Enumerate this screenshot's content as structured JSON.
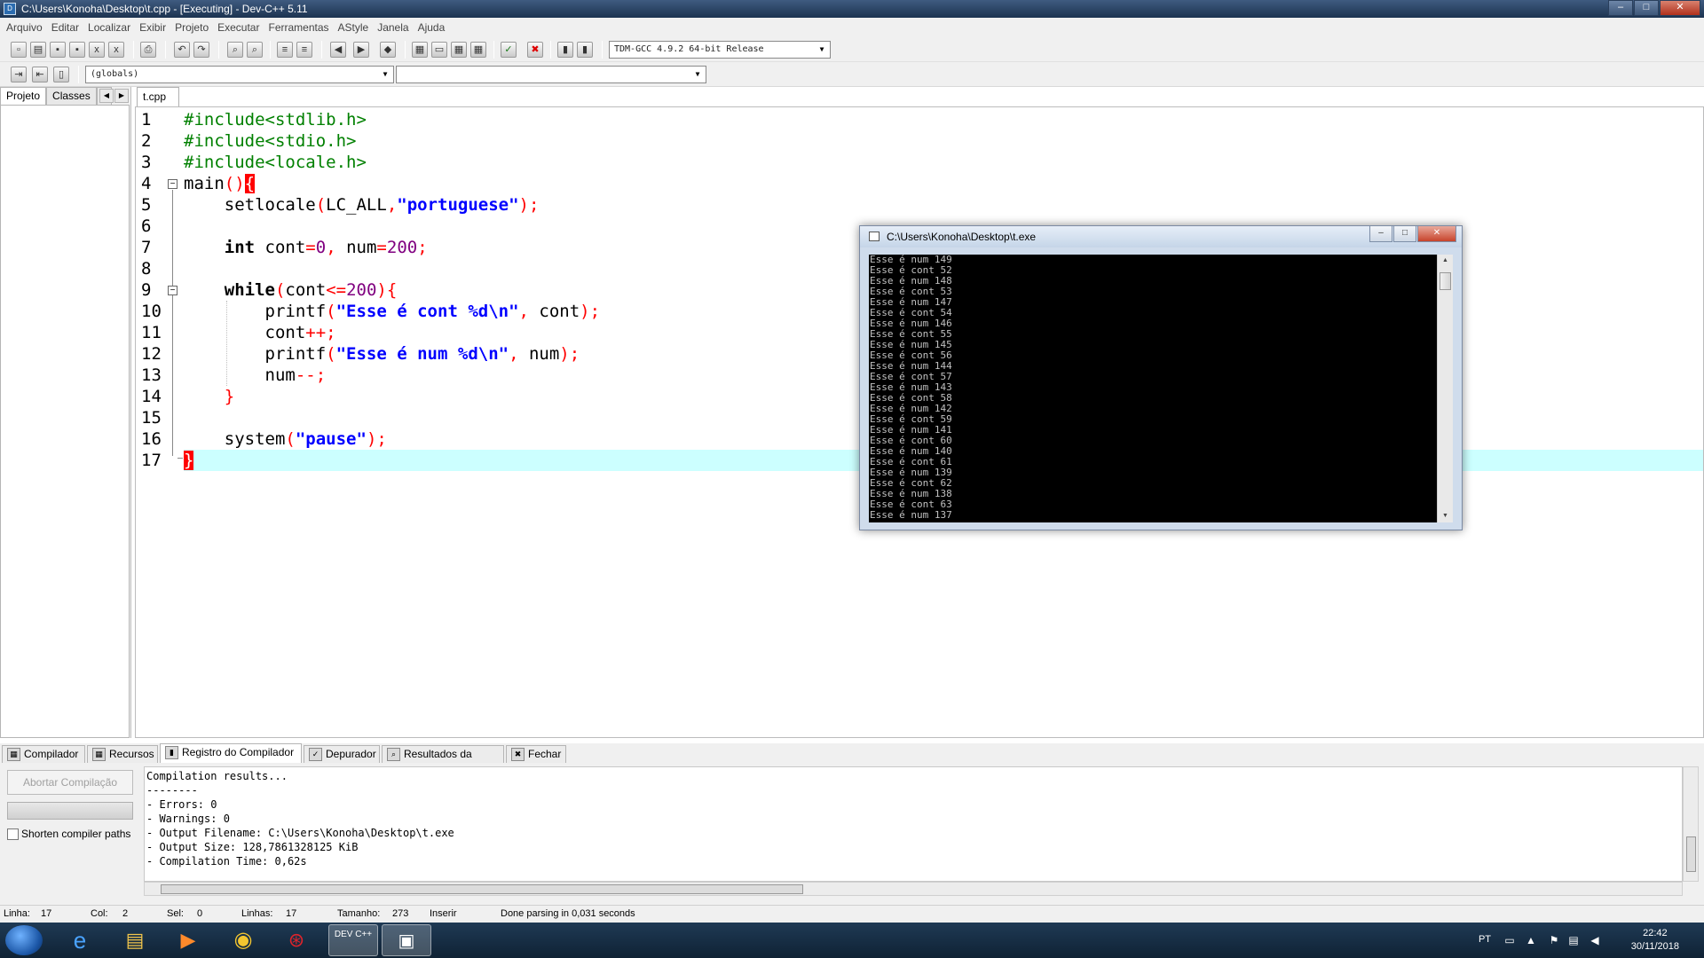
{
  "window": {
    "title": "C:\\Users\\Konoha\\Desktop\\t.cpp - [Executing] - Dev-C++ 5.11",
    "minimize": "‒",
    "maximize": "□",
    "close": "✕"
  },
  "menu": [
    "Arquivo",
    "Editar",
    "Localizar",
    "Exibir",
    "Projeto",
    "Executar",
    "Ferramentas",
    "AStyle",
    "Janela",
    "Ajuda"
  ],
  "toolbar": {
    "compiler_select": "TDM-GCC 4.9.2 64-bit Release",
    "globals_select": "(globals)",
    "members_select": ""
  },
  "left_panel": {
    "tabs": [
      "Projeto",
      "Classes",
      "["
    ]
  },
  "editor": {
    "tab": "t.cpp",
    "line_numbers": [
      "1",
      "2",
      "3",
      "4",
      "5",
      "6",
      "7",
      "8",
      "9",
      "10",
      "11",
      "12",
      "13",
      "14",
      "15",
      "16",
      "17"
    ],
    "current_line": 17
  },
  "code": {
    "l1": "#include<stdlib.h>",
    "l2": "#include<stdio.h>",
    "l3": "#include<locale.h>",
    "l4_main": "main",
    "l4_paren": "()",
    "l4_brace": "{",
    "l5_fn": "setlocale",
    "l5_open": "(",
    "l5_arg": "LC_ALL",
    "l5_comma": ",",
    "l5_str": "\"portuguese\"",
    "l5_close": ");",
    "l7_kw": "int",
    "l7_var1": " cont",
    "l7_eq1": "=",
    "l7_n1": "0",
    "l7_comma": ",",
    "l7_var2": " num",
    "l7_eq2": "=",
    "l7_n2": "200",
    "l7_semi": ";",
    "l9_kw": "while",
    "l9_open": "(",
    "l9_var": "cont",
    "l9_op": "<=",
    "l9_n": "200",
    "l9_close": "){",
    "l10_fn": "printf",
    "l10_open": "(",
    "l10_str": "\"Esse é cont %d\\n\"",
    "l10_comma": ",",
    "l10_var": " cont",
    "l10_close": ");",
    "l11_var": "cont",
    "l11_op": "++;",
    "l12_fn": "printf",
    "l12_open": "(",
    "l12_str": "\"Esse é num %d\\n\"",
    "l12_comma": ",",
    "l12_var": " num",
    "l12_close": ");",
    "l13_var": "num",
    "l13_op": "--;",
    "l14_brace": "}",
    "l16_fn": "system",
    "l16_open": "(",
    "l16_str": "\"pause\"",
    "l16_close": ");",
    "l17_brace": "}"
  },
  "console": {
    "title": "C:\\Users\\Konoha\\Desktop\\t.exe",
    "output": "Esse é num 149\nEsse é cont 52\nEsse é num 148\nEsse é cont 53\nEsse é num 147\nEsse é cont 54\nEsse é num 146\nEsse é cont 55\nEsse é num 145\nEsse é cont 56\nEsse é num 144\nEsse é cont 57\nEsse é num 143\nEsse é cont 58\nEsse é num 142\nEsse é cont 59\nEsse é num 141\nEsse é cont 60\nEsse é num 140\nEsse é cont 61\nEsse é num 139\nEsse é cont 62\nEsse é num 138\nEsse é cont 63\nEsse é num 137"
  },
  "bottom_tabs": [
    "Compilador",
    "Recursos",
    "Registro do Compilador",
    "Depurador",
    "Resultados da Busca",
    "Fechar"
  ],
  "bottom_panel": {
    "abort_button": "Abortar Compilação",
    "shorten_paths_label": "Shorten compiler paths",
    "log": "Compilation results...\n--------\n- Errors: 0\n- Warnings: 0\n- Output Filename: C:\\Users\\Konoha\\Desktop\\t.exe\n- Output Size: 128,7861328125 KiB\n- Compilation Time: 0,62s"
  },
  "status": {
    "linha_label": "Linha:",
    "linha": "17",
    "col_label": "Col:",
    "col": "2",
    "sel_label": "Sel:",
    "sel": "0",
    "linhas_label": "Linhas:",
    "linhas": "17",
    "tamanho_label": "Tamanho:",
    "tamanho": "273",
    "mode": "Inserir",
    "message": "Done parsing in 0,031 seconds"
  },
  "taskbar": {
    "apps": [
      "start",
      "internet-explorer",
      "file-explorer",
      "media-player",
      "chrome",
      "app-red",
      "dev-cpp",
      "console-app"
    ],
    "devcpp_label": "DEV C++",
    "language": "PT",
    "time": "22:42",
    "date": "30/11/2018"
  }
}
